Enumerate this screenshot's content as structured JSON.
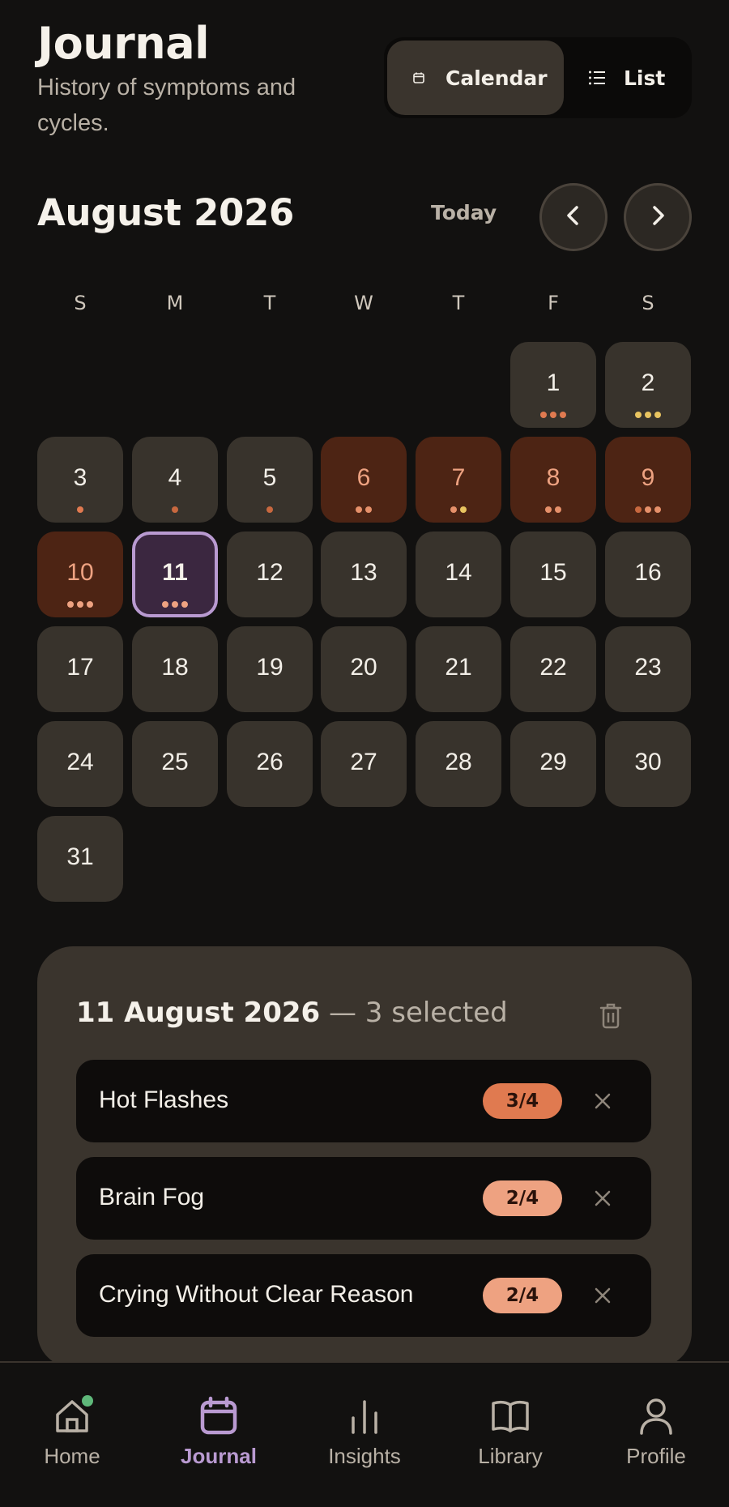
{
  "header": {
    "title": "Journal",
    "subtitle": "History of symptoms and cycles."
  },
  "view_toggle": {
    "calendar_label": "Calendar",
    "list_label": "List",
    "active": "Calendar"
  },
  "calendar": {
    "month_title": "August 2026",
    "today_label": "Today",
    "weekdays": [
      "S",
      "M",
      "T",
      "W",
      "T",
      "F",
      "S"
    ],
    "days": [
      {
        "n": "1",
        "kind": "normal",
        "dots": [
          "#e07a50",
          "#e07a50",
          "#e07a50"
        ]
      },
      {
        "n": "2",
        "kind": "normal",
        "dots": [
          "#e8c460",
          "#e8c460",
          "#e8c460"
        ]
      },
      {
        "n": "3",
        "kind": "normal",
        "dots": [
          "#e07a50"
        ]
      },
      {
        "n": "4",
        "kind": "normal",
        "dots": [
          "#c8683f"
        ]
      },
      {
        "n": "5",
        "kind": "normal",
        "dots": [
          "#c8683f"
        ]
      },
      {
        "n": "6",
        "kind": "period",
        "dots": [
          "#e6906a",
          "#e6906a"
        ]
      },
      {
        "n": "7",
        "kind": "period",
        "dots": [
          "#e6906a",
          "#e8c460"
        ]
      },
      {
        "n": "8",
        "kind": "period",
        "dots": [
          "#e6906a",
          "#e6906a"
        ]
      },
      {
        "n": "9",
        "kind": "period",
        "dots": [
          "#c8683f",
          "#e6906a",
          "#e6906a"
        ]
      },
      {
        "n": "10",
        "kind": "period",
        "dots": [
          "#eea281",
          "#eea281",
          "#eea281"
        ]
      },
      {
        "n": "11",
        "kind": "selected",
        "dots": [
          "#eea281",
          "#eea281",
          "#eea281"
        ]
      },
      {
        "n": "12",
        "kind": "normal",
        "dots": []
      },
      {
        "n": "13",
        "kind": "normal",
        "dots": []
      },
      {
        "n": "14",
        "kind": "normal",
        "dots": []
      },
      {
        "n": "15",
        "kind": "normal",
        "dots": []
      },
      {
        "n": "16",
        "kind": "normal",
        "dots": []
      },
      {
        "n": "17",
        "kind": "normal",
        "dots": []
      },
      {
        "n": "18",
        "kind": "normal",
        "dots": []
      },
      {
        "n": "19",
        "kind": "normal",
        "dots": []
      },
      {
        "n": "20",
        "kind": "normal",
        "dots": []
      },
      {
        "n": "21",
        "kind": "normal",
        "dots": []
      },
      {
        "n": "22",
        "kind": "normal",
        "dots": []
      },
      {
        "n": "23",
        "kind": "normal",
        "dots": []
      },
      {
        "n": "24",
        "kind": "normal",
        "dots": []
      },
      {
        "n": "25",
        "kind": "normal",
        "dots": []
      },
      {
        "n": "26",
        "kind": "normal",
        "dots": []
      },
      {
        "n": "27",
        "kind": "normal",
        "dots": []
      },
      {
        "n": "28",
        "kind": "normal",
        "dots": []
      },
      {
        "n": "29",
        "kind": "normal",
        "dots": []
      },
      {
        "n": "30",
        "kind": "normal",
        "dots": []
      },
      {
        "n": "31",
        "kind": "normal",
        "dots": []
      }
    ]
  },
  "detail": {
    "date": "11 August 2026",
    "selected_text": " — 3 selected",
    "entries": [
      {
        "name": "Hot Flashes",
        "severity": "3/4",
        "badge_color": "#e07a50"
      },
      {
        "name": "Brain Fog",
        "severity": "2/4",
        "badge_color": "#eea281"
      },
      {
        "name": "Crying Without Clear Reason",
        "severity": "2/4",
        "badge_color": "#eea281"
      }
    ]
  },
  "bottom_nav": {
    "items": [
      {
        "label": "Home",
        "icon": "home-icon",
        "has_notification": true
      },
      {
        "label": "Journal",
        "icon": "calendar-icon",
        "active": true
      },
      {
        "label": "Insights",
        "icon": "bar-chart-icon"
      },
      {
        "label": "Library",
        "icon": "book-icon"
      },
      {
        "label": "Profile",
        "icon": "user-icon"
      }
    ]
  },
  "colors": {
    "background": "#121110",
    "card": "#38332c",
    "period": "#4d2414",
    "accent_purple": "#b99ad1"
  }
}
